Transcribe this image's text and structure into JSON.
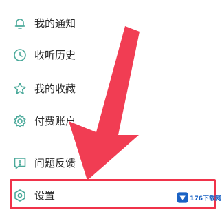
{
  "menu": {
    "items": [
      {
        "label": "我的通知",
        "icon": "bell-icon"
      },
      {
        "label": "收听历史",
        "icon": "clock-icon"
      },
      {
        "label": "我的收藏",
        "icon": "star-icon"
      },
      {
        "label": "付费账户",
        "icon": "gear-icon"
      },
      {
        "label": "问题反馈",
        "icon": "feedback-icon"
      },
      {
        "label": "设置",
        "icon": "settings-hexagon-icon"
      }
    ]
  },
  "annotation": {
    "arrow_color": "#f0334a",
    "highlight_color": "#f0334a"
  },
  "watermark": {
    "text": "176下载网"
  },
  "colors": {
    "icon": "#4aa99a",
    "text": "#2a2a2a",
    "background": "#ffffff"
  }
}
